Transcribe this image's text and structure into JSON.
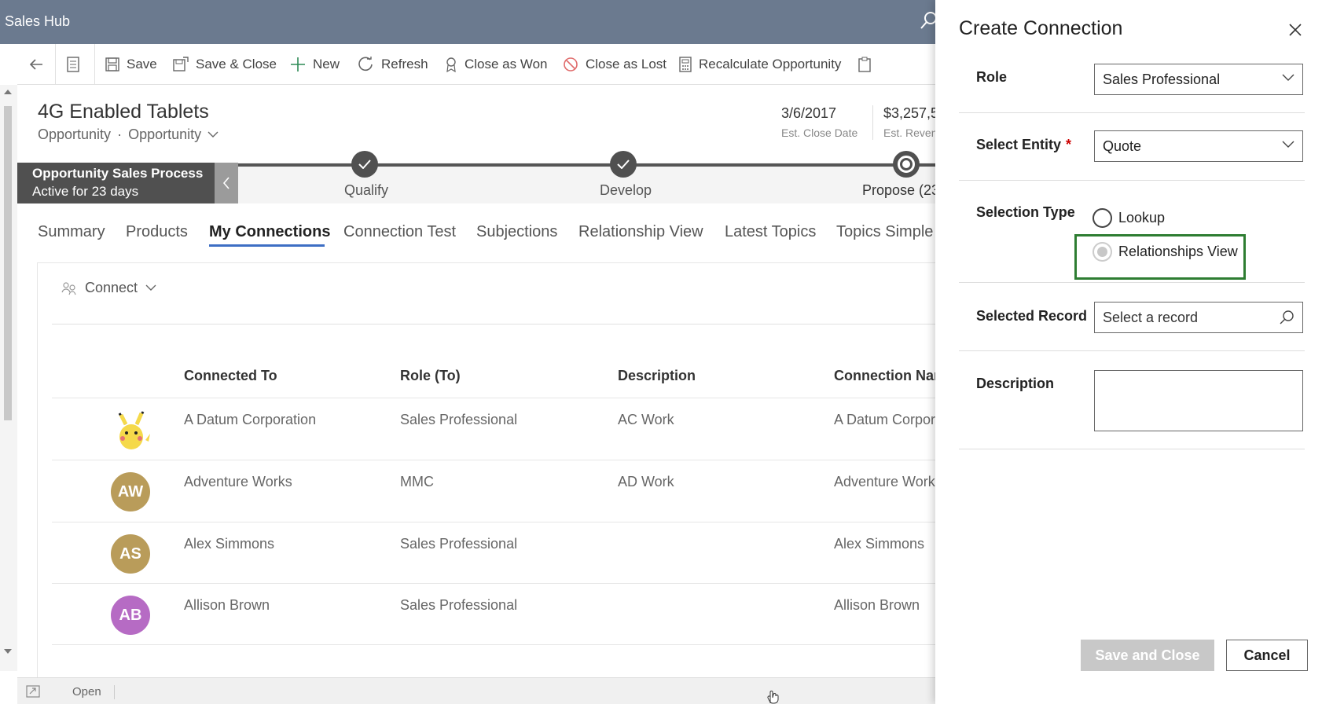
{
  "app": {
    "title": "Sales Hub"
  },
  "commandbar": {
    "save": "Save",
    "save_close": "Save & Close",
    "new": "New",
    "refresh": "Refresh",
    "close_won": "Close as Won",
    "close_lost": "Close as Lost",
    "recalculate": "Recalculate Opportunity"
  },
  "record": {
    "title": "4G Enabled Tablets",
    "entity": "Opportunity",
    "form": "Opportunity",
    "close_date": "3/6/2017",
    "close_date_label": "Est. Close Date",
    "revenue": "$3,257,5",
    "revenue_label": "Est. Reven"
  },
  "process": {
    "name": "Opportunity Sales Process",
    "age": "Active for 23 days",
    "stages": [
      "Qualify",
      "Develop",
      "Propose (23"
    ]
  },
  "tabs": [
    "Summary",
    "Products",
    "My Connections",
    "Connection Test",
    "Subjections",
    "Relationship View",
    "Latest Topics",
    "Topics Simple"
  ],
  "connections": {
    "connect_label": "Connect",
    "columns": [
      "Connected To",
      "Role (To)",
      "Description",
      "Connection Nam"
    ],
    "rows": [
      {
        "initials": "",
        "connected_to": "A Datum Corporation",
        "role": "Sales Professional",
        "description": "AC Work",
        "name": "A Datum Corpora",
        "color": "#f5d94a"
      },
      {
        "initials": "AW",
        "connected_to": "Adventure Works",
        "role": "MMC",
        "description": "AD Work",
        "name": "Adventure Works",
        "color": "#b99c5a"
      },
      {
        "initials": "AS",
        "connected_to": "Alex Simmons",
        "role": "Sales Professional",
        "description": "",
        "name": "Alex Simmons",
        "color": "#b99c5a"
      },
      {
        "initials": "AB",
        "connected_to": "Allison Brown",
        "role": "Sales Professional",
        "description": "",
        "name": "Allison Brown",
        "color": "#b66bc4"
      }
    ]
  },
  "footer": {
    "status": "Open"
  },
  "panel": {
    "title": "Create Connection",
    "role_label": "Role",
    "role_value": "Sales Professional",
    "entity_label": "Select Entity",
    "entity_required": "*",
    "entity_value": "Quote",
    "selection_label": "Selection Type",
    "option_lookup": "Lookup",
    "option_relview": "Relationships View",
    "record_label": "Selected Record",
    "record_placeholder": "Select a record",
    "description_label": "Description",
    "save_close": "Save and Close",
    "cancel": "Cancel"
  },
  "colors": {
    "topbar": "#6b7a8f",
    "accent": "#3d6ec4",
    "highlight": "#2e7d32"
  }
}
